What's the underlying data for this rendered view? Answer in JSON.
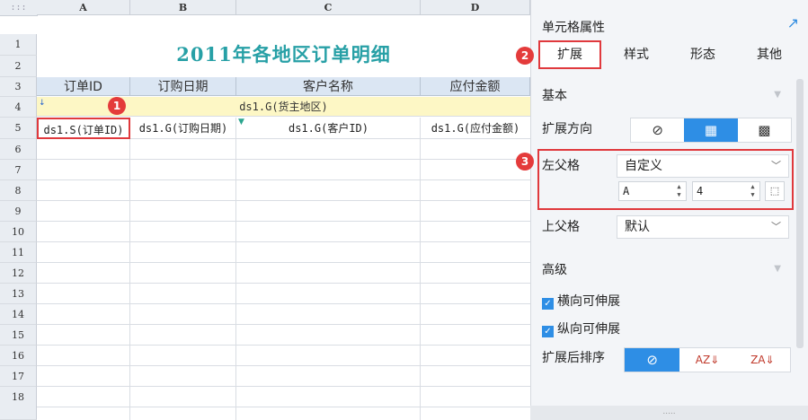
{
  "sheet": {
    "corner_label": ":::",
    "columns": [
      "A",
      "B",
      "C",
      "D"
    ],
    "rows": [
      "1",
      "2",
      "3",
      "4",
      "5",
      "6",
      "7",
      "8",
      "9",
      "10",
      "11",
      "12",
      "13",
      "14",
      "15",
      "16",
      "17",
      "18"
    ],
    "title": "2011年各地区订单明细",
    "headers": [
      "订单ID",
      "订购日期",
      "客户名称",
      "应付金额"
    ],
    "row4_value": "ds1.G(货主地区)",
    "row5": [
      "ds1.S(订单ID)",
      "ds1.G(订购日期)",
      "ds1.G(客户ID)",
      "ds1.G(应付金额)"
    ]
  },
  "badges": {
    "b1": "1",
    "b2": "2",
    "b3": "3"
  },
  "panel": {
    "title": "单元格属性",
    "pin_icon": "↗",
    "tabs": [
      "扩展",
      "样式",
      "形态",
      "其他"
    ],
    "basic": {
      "label": "基本",
      "expand_direction_label": "扩展方向",
      "left_parent_label": "左父格",
      "left_parent_value": "自定义",
      "left_parent_col": "A",
      "left_parent_row": "4",
      "top_parent_label": "上父格",
      "top_parent_value": "默认"
    },
    "advanced": {
      "label": "高级",
      "horizontal_expandable": "横向可伸展",
      "vertical_expandable": "纵向可伸展",
      "sort_label": "扩展后排序"
    },
    "bottom_grip": "....."
  },
  "colors": {
    "accent": "#2e8ee5",
    "title": "#27a0a6",
    "highlight": "#e0393d",
    "yellow_row": "#fdf7c5",
    "header_row": "#dbe6f3"
  }
}
